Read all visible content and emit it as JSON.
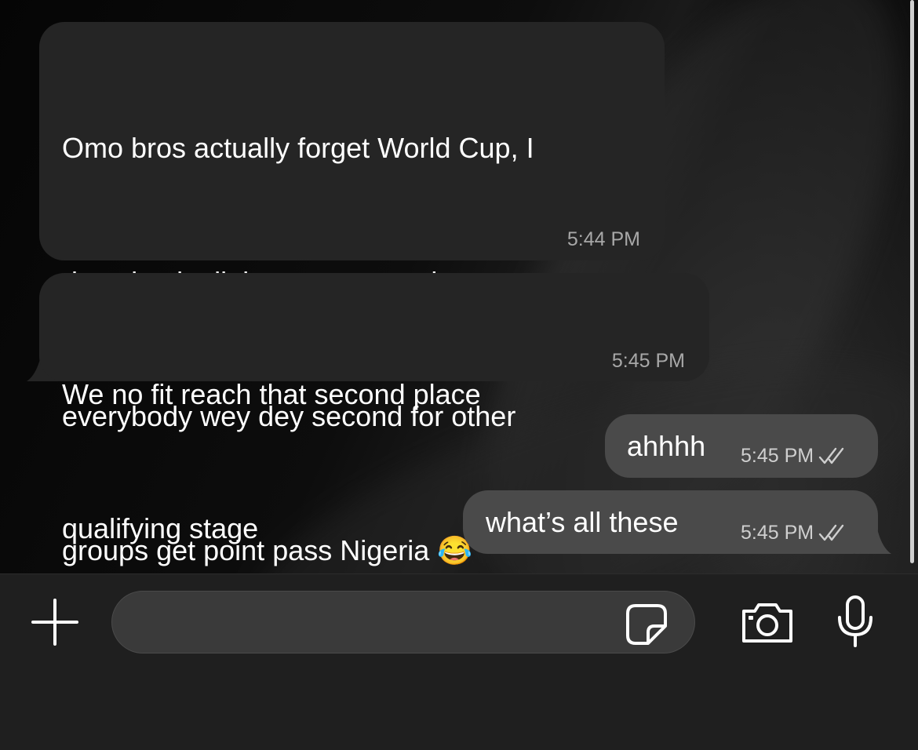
{
  "messages": [
    {
      "direction": "incoming",
      "lines": [
        "Omo bros actually forget World Cup, I",
        "don check all the groups na almost",
        "everybody wey dey second for other",
        "groups get point pass Nigeria 😂"
      ],
      "time": "5:44 PM",
      "status": null
    },
    {
      "direction": "incoming",
      "lines": [
        "We no fit reach that second place",
        "qualifying stage"
      ],
      "time": "5:45 PM",
      "status": null
    },
    {
      "direction": "outgoing",
      "lines": [
        "ahhhh"
      ],
      "time": "5:45 PM",
      "status": "read-double-tick"
    },
    {
      "direction": "outgoing",
      "lines": [
        "what’s all these"
      ],
      "time": "5:45 PM",
      "status": "read-double-tick"
    }
  ],
  "composer": {
    "input_value": "",
    "placeholder": "",
    "attach_icon": "plus-icon",
    "sticker_icon": "sticker-icon",
    "camera_icon": "camera-icon",
    "mic_icon": "microphone-icon"
  },
  "colors": {
    "incoming_bubble": "#252525",
    "outgoing_bubble": "#4a4a4a",
    "input_bar": "#1f1f1f",
    "text": "#ffffff",
    "timestamp": "#a8a8a8"
  }
}
